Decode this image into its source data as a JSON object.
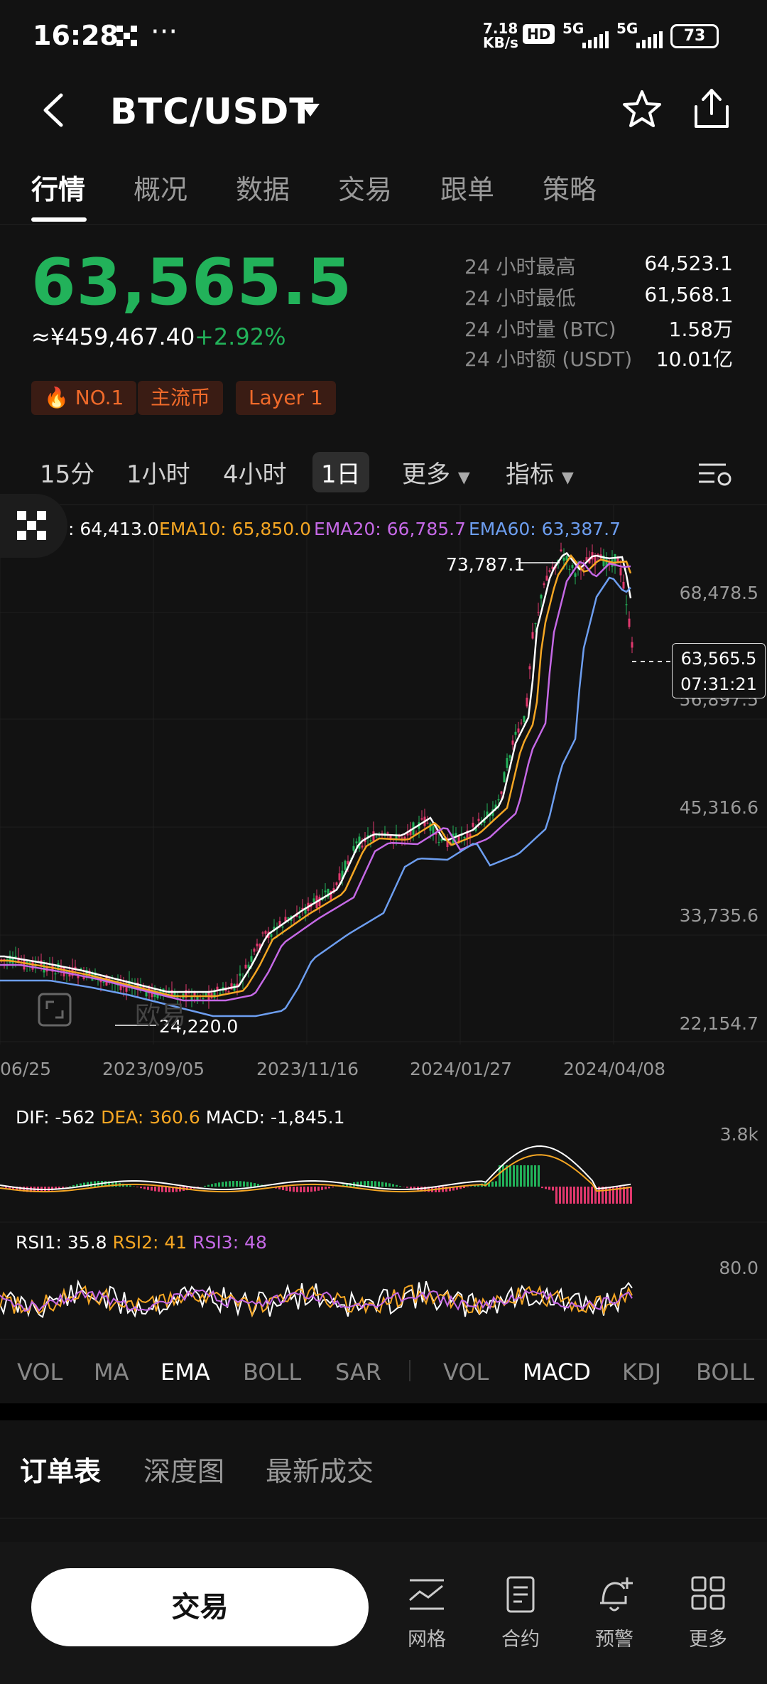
{
  "status_bar": {
    "time": "16:28",
    "net_speed_top": "7.18",
    "net_speed_bottom": "KB/s",
    "hd": "HD",
    "signal1": "5G",
    "signal2": "5G",
    "battery": "73"
  },
  "header": {
    "pair": "BTC/USDT"
  },
  "tabs": [
    "行情",
    "概况",
    "数据",
    "交易",
    "跟单",
    "策略"
  ],
  "ticker": {
    "price": "63,565.5",
    "cny": "≈¥459,467.40",
    "change": "+2.92%",
    "badges": [
      "NO.1",
      "主流币",
      "Layer 1"
    ],
    "stats": [
      {
        "label": "24 小时最高",
        "value": "64,523.1"
      },
      {
        "label": "24 小时最低",
        "value": "61,568.1"
      },
      {
        "label": "24 小时量 (BTC)",
        "value": "1.58万"
      },
      {
        "label": "24 小时额 (USDT)",
        "value": "10.01亿"
      }
    ]
  },
  "intervals": [
    "15分",
    "1小时",
    "4小时",
    "1日",
    "更多",
    "指标"
  ],
  "ema_legend": {
    "ema5": ": 64,413.0",
    "ema10": "EMA10: 65,850.0",
    "ema20": "EMA20: 66,785.7",
    "ema60": "EMA60: 63,387.7"
  },
  "chart": {
    "high_label": "73,787.1",
    "low_label": "24,220.0",
    "price_tag": "63,565.5",
    "countdown": "07:31:21",
    "y_ticks": [
      "68,478.5",
      "56,897.5",
      "45,316.6",
      "33,735.6",
      "22,154.7"
    ],
    "x_ticks": [
      "06/25",
      "2023/09/05",
      "2023/11/16",
      "2024/01/27",
      "2024/04/08"
    ],
    "watermark": "欧易"
  },
  "macd": {
    "dif": "DIF: -562",
    "dea": "DEA: 360.6",
    "macd": "MACD: -1,845.1",
    "y_tick": "3.8k"
  },
  "rsi": {
    "rsi1": "RSI1: 35.8",
    "rsi2": "RSI2: 41",
    "rsi3": "RSI3: 48",
    "y_tick": "80.0"
  },
  "indicator_bar": [
    "VOL",
    "MA",
    "EMA",
    "BOLL",
    "SAR",
    "VOL",
    "MACD",
    "KDJ",
    "BOLL"
  ],
  "orderbook_tabs": [
    "订单表",
    "深度图",
    "最新成交"
  ],
  "bottom_bar": {
    "trade": "交易",
    "items": [
      "网格",
      "合约",
      "预警",
      "更多"
    ]
  },
  "colors": {
    "up": "#22b25a",
    "down": "#e0386d",
    "ema10": "#f5a623",
    "ema20": "#c569e6",
    "ema60": "#6d9ef0"
  }
}
